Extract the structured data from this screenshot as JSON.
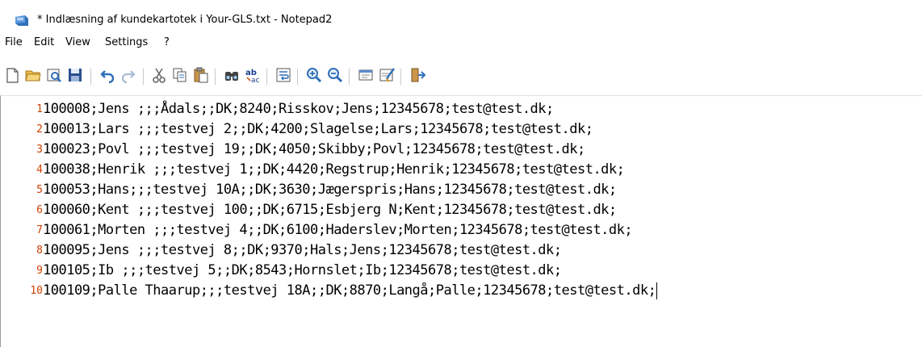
{
  "window": {
    "title": "* Indlæsning af kundekartotek i Your-GLS.txt - Notepad2"
  },
  "menu": {
    "items": [
      "File",
      "Edit",
      "View",
      "Settings",
      "?"
    ]
  },
  "toolbar": {
    "buttons": [
      {
        "icon": "new-file-icon"
      },
      {
        "icon": "open-folder-icon"
      },
      {
        "icon": "browse-icon"
      },
      {
        "icon": "save-icon"
      },
      {
        "icon": "undo-icon"
      },
      {
        "icon": "redo-icon"
      },
      {
        "icon": "cut-icon"
      },
      {
        "icon": "copy-icon"
      },
      {
        "icon": "paste-icon"
      },
      {
        "icon": "find-icon"
      },
      {
        "icon": "replace-icon"
      },
      {
        "icon": "word-wrap-icon"
      },
      {
        "icon": "zoom-in-icon"
      },
      {
        "icon": "zoom-out-icon"
      },
      {
        "icon": "scheme-icon"
      },
      {
        "icon": "customize-icon"
      },
      {
        "icon": "exit-icon"
      }
    ]
  },
  "editor": {
    "lines": [
      {
        "number": "1",
        "text": "100008;Jens ;;;Ådals;;DK;8240;Risskov;Jens;12345678;test@test.dk;"
      },
      {
        "number": "2",
        "text": "100013;Lars ;;;testvej 2;;DK;4200;Slagelse;Lars;12345678;test@test.dk;"
      },
      {
        "number": "3",
        "text": "100023;Povl ;;;testvej 19;;DK;4050;Skibby;Povl;12345678;test@test.dk;"
      },
      {
        "number": "4",
        "text": "100038;Henrik ;;;testvej 1;;DK;4420;Regstrup;Henrik;12345678;test@test.dk;"
      },
      {
        "number": "5",
        "text": "100053;Hans;;;testvej 10A;;DK;3630;Jægerspris;Hans;12345678;test@test.dk;"
      },
      {
        "number": "6",
        "text": "100060;Kent ;;;testvej 100;;DK;6715;Esbjerg N;Kent;12345678;test@test.dk;"
      },
      {
        "number": "7",
        "text": "100061;Morten ;;;testvej 4;;DK;6100;Haderslev;Morten;12345678;test@test.dk;"
      },
      {
        "number": "8",
        "text": "100095;Jens ;;;testvej 8;;DK;9370;Hals;Jens;12345678;test@test.dk;"
      },
      {
        "number": "9",
        "text": "100105;Ib ;;;testvej 5;;DK;8543;Hornslet;Ib;12345678;test@test.dk;"
      },
      {
        "number": "10",
        "text": "100109;Palle Thaarup;;;testvej 18A;;DK;8870;Langå;Palle;12345678;test@test.dk;"
      }
    ],
    "caret_line": "10"
  }
}
